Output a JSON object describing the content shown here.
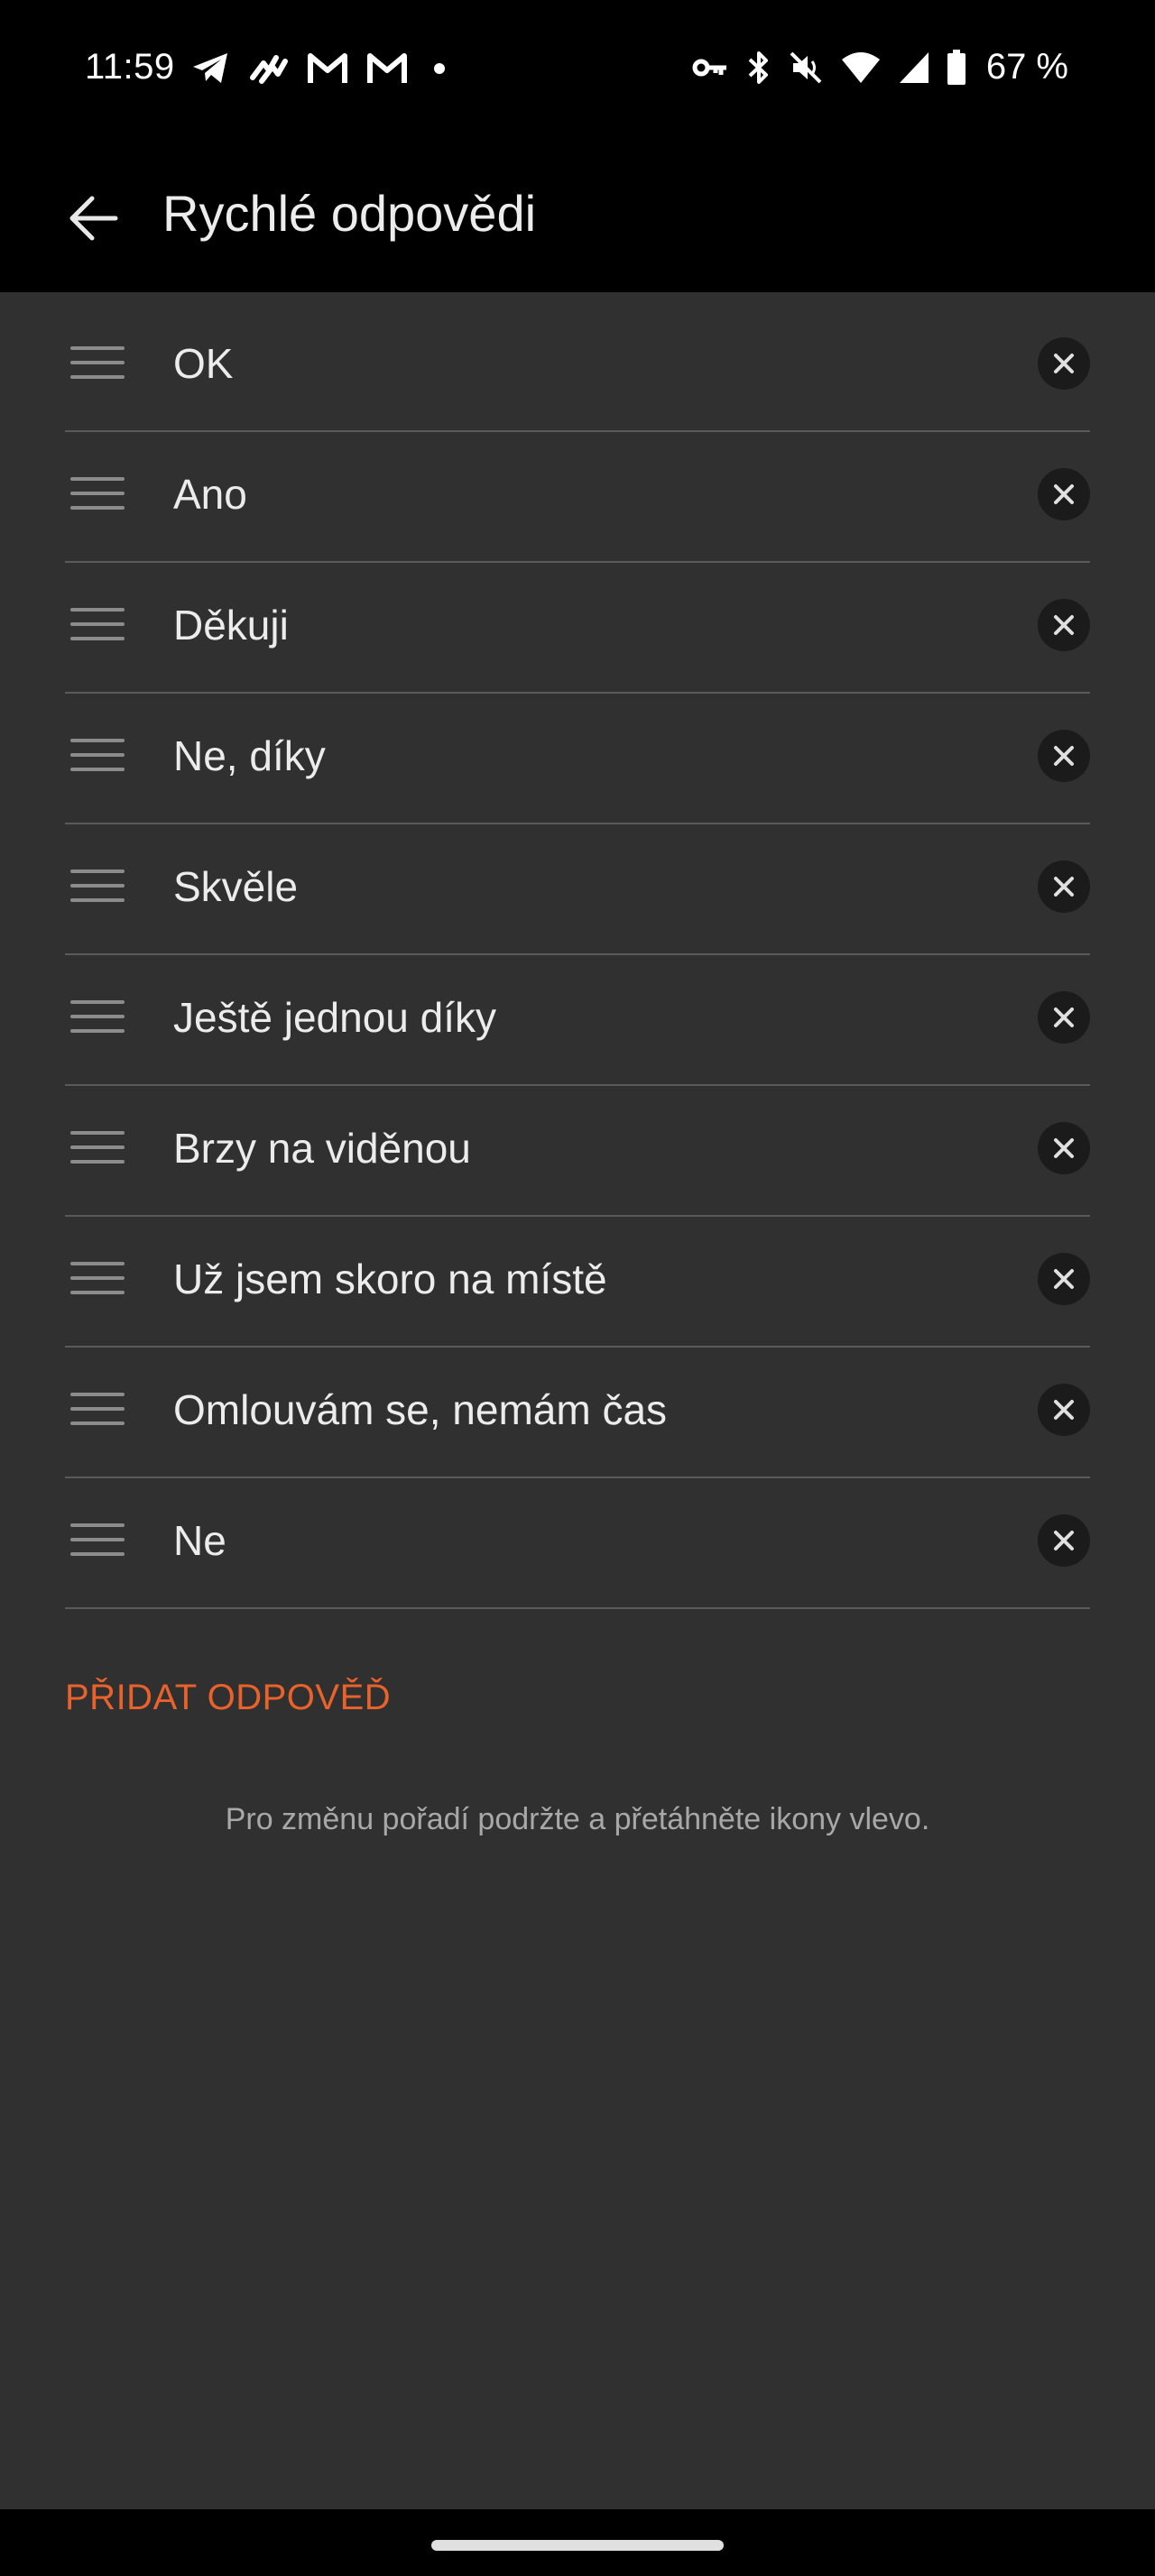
{
  "status_bar": {
    "time": "11:59",
    "left_icons": [
      "telegram-icon",
      "messenger-icon",
      "gmail-icon",
      "gmail-icon",
      "dot-icon"
    ],
    "right_icons": [
      "vpn-key-icon",
      "bluetooth-icon",
      "mute-icon",
      "wifi-icon",
      "signal-icon",
      "battery-icon"
    ],
    "battery": "67 %"
  },
  "app_bar": {
    "title": "Rychlé odpovědi"
  },
  "replies": [
    {
      "text": "OK"
    },
    {
      "text": "Ano"
    },
    {
      "text": "Děkuji"
    },
    {
      "text": "Ne, díky"
    },
    {
      "text": "Skvěle"
    },
    {
      "text": "Ještě jednou díky"
    },
    {
      "text": "Brzy na viděnou"
    },
    {
      "text": "Už jsem skoro na místě"
    },
    {
      "text": "Omlouvám se, nemám čas"
    },
    {
      "text": "Ne"
    }
  ],
  "add_button": "PŘIDAT ODPOVĚĎ",
  "hint": "Pro změnu pořadí podržte a přetáhněte ikony vlevo.",
  "colors": {
    "accent": "#e9622b",
    "background": "#303030",
    "bar": "#000000"
  }
}
